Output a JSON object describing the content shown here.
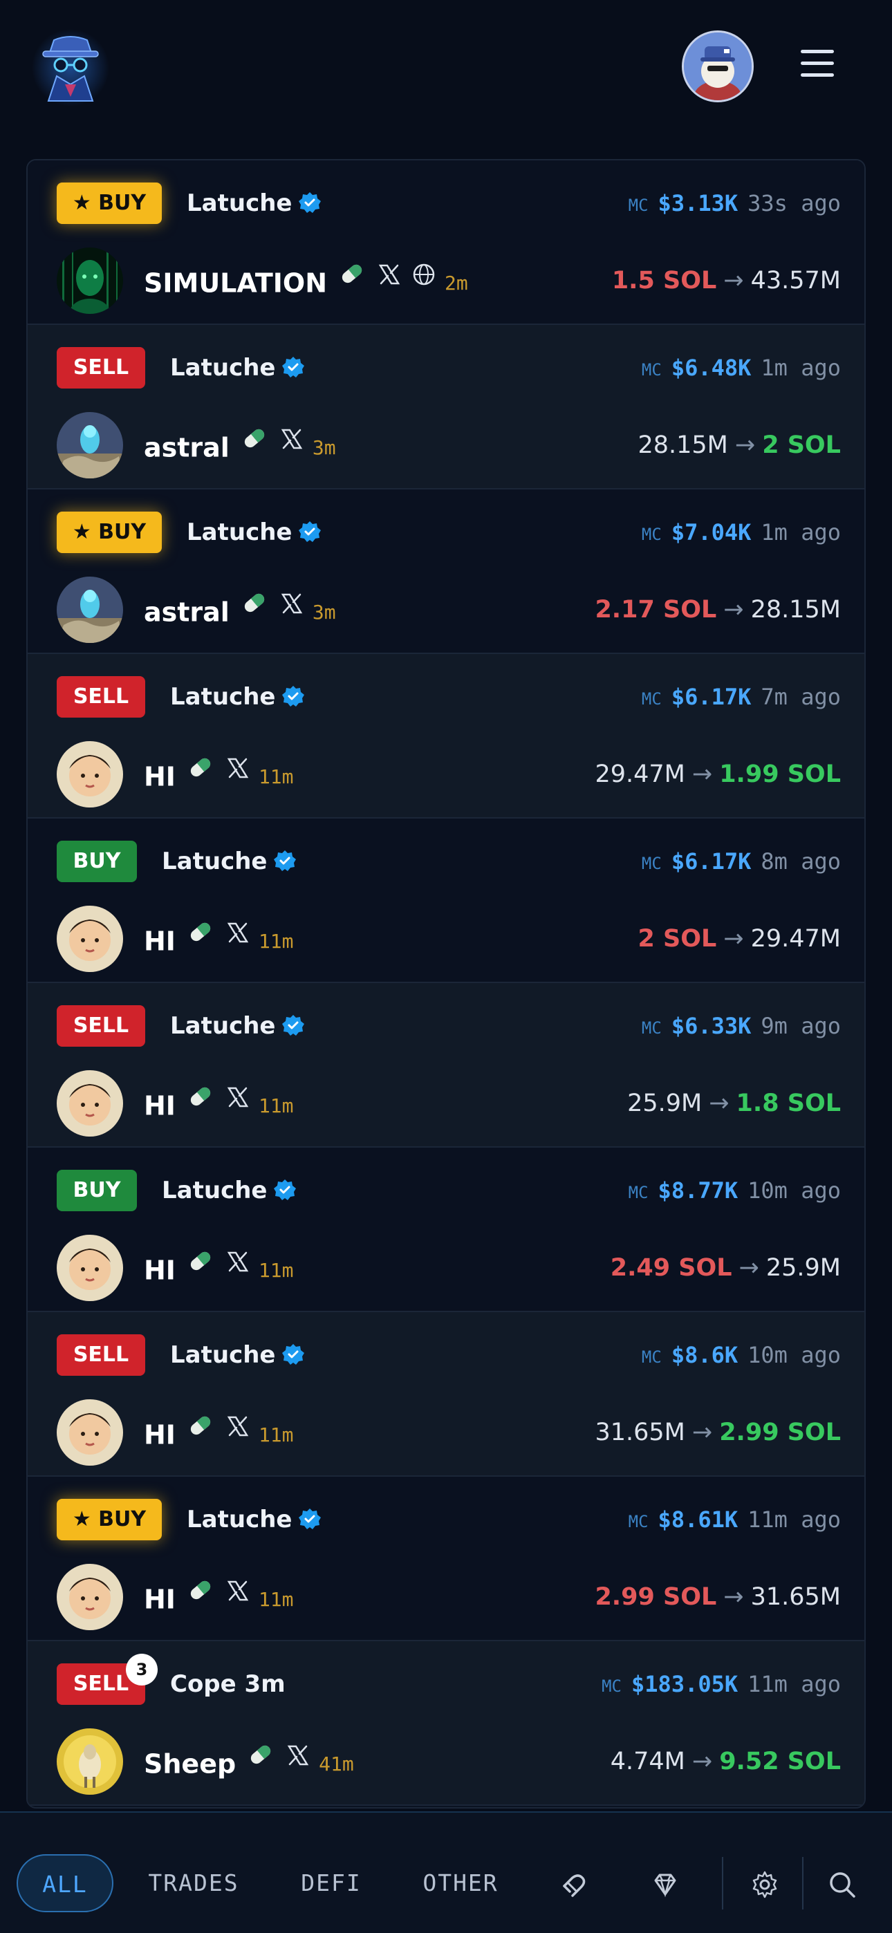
{
  "header": {
    "logo": "detective-logo-icon",
    "avatar": "user-avatar",
    "menu": "hamburger-menu-icon"
  },
  "feed": [
    {
      "badge_type": "starbuy",
      "badge": "★ BUY",
      "trader": "Latuche",
      "verified": true,
      "mc_label": "MC",
      "mc": "$3.13K",
      "ago": "33s ago",
      "token": "SIMULATION",
      "links": [
        "pill-icon",
        "x-icon",
        "globe-icon"
      ],
      "age": "2m",
      "from": "1.5 SOL",
      "to": "43.57M",
      "direction": "buy"
    },
    {
      "badge_type": "sell",
      "badge": "SELL",
      "trader": "Latuche",
      "verified": true,
      "mc_label": "MC",
      "mc": "$6.48K",
      "ago": "1m ago",
      "token": "astral",
      "links": [
        "pill-icon",
        "x-icon"
      ],
      "age": "3m",
      "from": "28.15M",
      "to": "2 SOL",
      "direction": "sell"
    },
    {
      "badge_type": "starbuy",
      "badge": "★ BUY",
      "trader": "Latuche",
      "verified": true,
      "mc_label": "MC",
      "mc": "$7.04K",
      "ago": "1m ago",
      "token": "astral",
      "links": [
        "pill-icon",
        "x-icon"
      ],
      "age": "3m",
      "from": "2.17 SOL",
      "to": "28.15M",
      "direction": "buy"
    },
    {
      "badge_type": "sell",
      "badge": "SELL",
      "trader": "Latuche",
      "verified": true,
      "mc_label": "MC",
      "mc": "$6.17K",
      "ago": "7m ago",
      "token": "HI",
      "links": [
        "pill-icon",
        "x-icon"
      ],
      "age": "11m",
      "from": "29.47M",
      "to": "1.99 SOL",
      "direction": "sell"
    },
    {
      "badge_type": "buy",
      "badge": "BUY",
      "trader": "Latuche",
      "verified": true,
      "mc_label": "MC",
      "mc": "$6.17K",
      "ago": "8m ago",
      "token": "HI",
      "links": [
        "pill-icon",
        "x-icon"
      ],
      "age": "11m",
      "from": "2 SOL",
      "to": "29.47M",
      "direction": "buy"
    },
    {
      "badge_type": "sell",
      "badge": "SELL",
      "trader": "Latuche",
      "verified": true,
      "mc_label": "MC",
      "mc": "$6.33K",
      "ago": "9m ago",
      "token": "HI",
      "links": [
        "pill-icon",
        "x-icon"
      ],
      "age": "11m",
      "from": "25.9M",
      "to": "1.8 SOL",
      "direction": "sell"
    },
    {
      "badge_type": "buy",
      "badge": "BUY",
      "trader": "Latuche",
      "verified": true,
      "mc_label": "MC",
      "mc": "$8.77K",
      "ago": "10m ago",
      "token": "HI",
      "links": [
        "pill-icon",
        "x-icon"
      ],
      "age": "11m",
      "from": "2.49 SOL",
      "to": "25.9M",
      "direction": "buy"
    },
    {
      "badge_type": "sell",
      "badge": "SELL",
      "trader": "Latuche",
      "verified": true,
      "mc_label": "MC",
      "mc": "$8.6K",
      "ago": "10m ago",
      "token": "HI",
      "links": [
        "pill-icon",
        "x-icon"
      ],
      "age": "11m",
      "from": "31.65M",
      "to": "2.99 SOL",
      "direction": "sell"
    },
    {
      "badge_type": "starbuy",
      "badge": "★ BUY",
      "trader": "Latuche",
      "verified": true,
      "mc_label": "MC",
      "mc": "$8.61K",
      "ago": "11m ago",
      "token": "HI",
      "links": [
        "pill-icon",
        "x-icon"
      ],
      "age": "11m",
      "from": "2.99 SOL",
      "to": "31.65M",
      "direction": "buy"
    },
    {
      "badge_type": "sell",
      "badge": "SELL",
      "badge_count": "3",
      "trader": "Cope 3m",
      "verified": false,
      "mc_label": "MC",
      "mc": "$183.05K",
      "ago": "11m ago",
      "token": "Sheep",
      "links": [
        "pill-icon",
        "x-icon"
      ],
      "age": "41m",
      "from": "4.74M",
      "to": "9.52 SOL",
      "direction": "sell"
    }
  ],
  "bottom_nav": {
    "tabs": [
      {
        "label": "ALL",
        "active": true
      },
      {
        "label": "TRADES",
        "active": false
      },
      {
        "label": "DEFI",
        "active": false
      },
      {
        "label": "OTHER",
        "active": false
      }
    ],
    "icons": [
      "magnet-icon",
      "gem-icon",
      "gear-icon",
      "search-icon"
    ]
  },
  "colors": {
    "buy_star": "#f5b91c",
    "sell": "#d0232b",
    "buy": "#1f8a3d",
    "mc": "#4aa8ff",
    "sol_out": "#e3595a",
    "sol_in": "#38c95f"
  }
}
